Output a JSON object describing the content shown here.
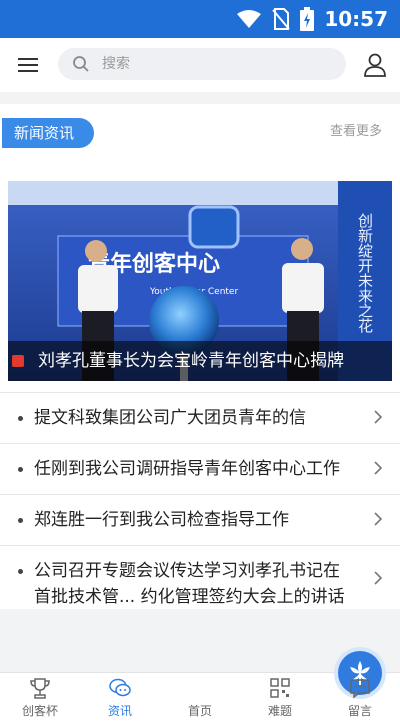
{
  "status_bar": {
    "time": "10:57"
  },
  "search": {
    "placeholder": "搜索"
  },
  "news_section": {
    "title": "新闻资讯",
    "more_label": "查看更多",
    "banner": {
      "caption": "刘孝孔董事长为会宝岭青年创客中心揭牌",
      "sign_text": "青年创客中心",
      "sign_subtext": "Youth Maker Center",
      "side_text": "创新绽开未来之花"
    },
    "items": [
      "提文科致集团公司广大团员青年的信",
      "任刚到我公司调研指导青年创客中心工作",
      "郑连胜一行到我公司检查指导工作",
      "公司召开专题会议传达学习刘孝孔书记在首批技术管... 约化管理签约大会上的讲话"
    ]
  },
  "bottom_nav": {
    "items": [
      {
        "label": "创客杯",
        "icon": "trophy-icon"
      },
      {
        "label": "资讯",
        "icon": "chat-icon",
        "active": true
      },
      {
        "label": "首页",
        "icon": "home-flower-icon"
      },
      {
        "label": "难题",
        "icon": "qrcode-icon"
      },
      {
        "label": "留言",
        "icon": "message-icon"
      }
    ]
  },
  "colors": {
    "primary": "#1f6fd6",
    "accent": "#3a8ae8",
    "active_tab": "#2f7be0"
  }
}
